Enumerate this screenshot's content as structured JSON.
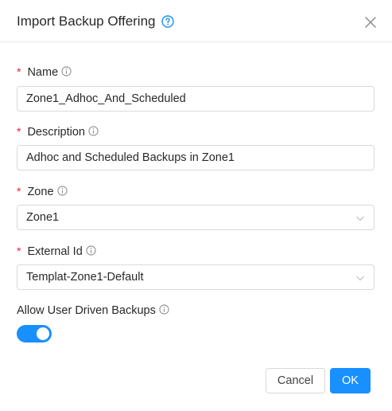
{
  "dialog": {
    "title": "Import Backup Offering",
    "close_icon": "close-icon",
    "help_icon": "question-circle-icon"
  },
  "form": {
    "name": {
      "label": "Name",
      "required": true,
      "value": "Zone1_Adhoc_And_Scheduled"
    },
    "description": {
      "label": "Description",
      "required": true,
      "value": "Adhoc and Scheduled Backups in Zone1"
    },
    "zone": {
      "label": "Zone",
      "required": true,
      "value": "Zone1"
    },
    "external_id": {
      "label": "External Id",
      "required": true,
      "value": "Templat-Zone1-Default"
    },
    "allow_user_driven_backups": {
      "label": "Allow User Driven Backups",
      "enabled": true
    }
  },
  "footer": {
    "cancel_label": "Cancel",
    "ok_label": "OK"
  },
  "colors": {
    "primary": "#1890ff",
    "required": "#f5222d",
    "border": "#d9d9d9"
  }
}
